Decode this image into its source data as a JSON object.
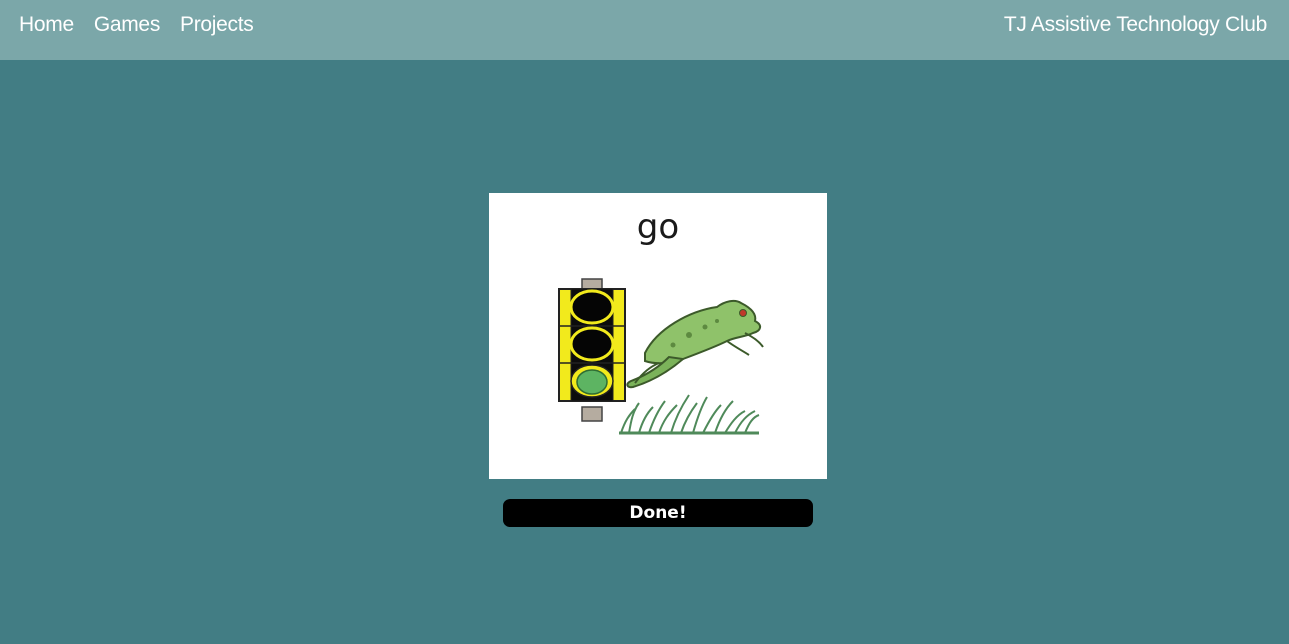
{
  "nav": {
    "links": [
      {
        "label": "Home"
      },
      {
        "label": "Games"
      },
      {
        "label": "Projects"
      }
    ],
    "brand": "TJ Assistive Technology Club"
  },
  "card": {
    "word": "go",
    "icons": [
      "traffic-light-icon",
      "leaping-frog-icon",
      "grass-icon"
    ]
  },
  "done_button": {
    "label": "Done!"
  },
  "colors": {
    "background": "#427d84",
    "navbar": "#7ba7a9",
    "button": "#000000"
  }
}
